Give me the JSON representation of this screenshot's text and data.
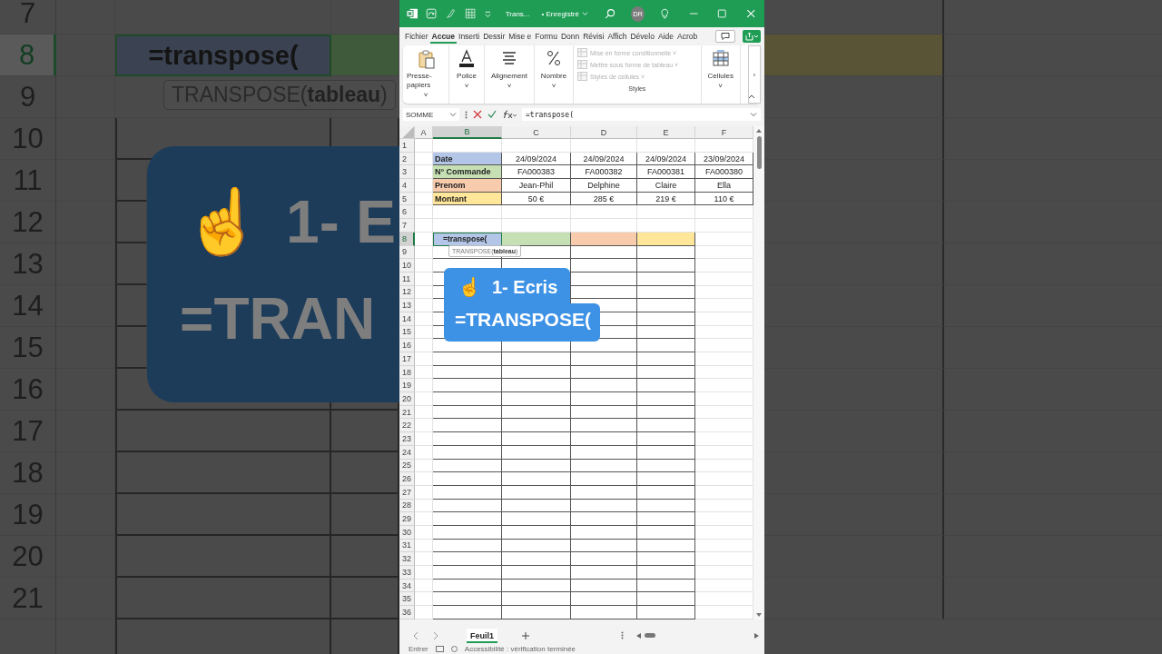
{
  "backdrop": {
    "rows": [
      {
        "number": "7",
        "selected": false
      },
      {
        "number": "8",
        "selected": true
      },
      {
        "number": "9",
        "selected": false
      },
      {
        "number": "10",
        "selected": false
      },
      {
        "number": "11",
        "selected": false
      },
      {
        "number": "12",
        "selected": false
      },
      {
        "number": "13",
        "selected": false
      },
      {
        "number": "14",
        "selected": false
      },
      {
        "number": "15",
        "selected": false
      },
      {
        "number": "16",
        "selected": false
      },
      {
        "number": "17",
        "selected": false
      },
      {
        "number": "18",
        "selected": false
      },
      {
        "number": "19",
        "selected": false
      },
      {
        "number": "20",
        "selected": false
      },
      {
        "number": "21",
        "selected": false
      }
    ],
    "cell_text": "=transpose(",
    "tooltip": "TRANSPOSE(**tableau**)",
    "callout_icon": "☝",
    "callout_lines": [
      "1- E",
      "=TRAN"
    ]
  },
  "window": {
    "title": "Trans...",
    "save_status": "• Enregistré",
    "avatar": "DR"
  },
  "ribbon_tabs": [
    {
      "label": "Fichier",
      "selected": false
    },
    {
      "label": "Accue",
      "selected": true
    },
    {
      "label": "Inserti",
      "selected": false
    },
    {
      "label": "Dessir",
      "selected": false
    },
    {
      "label": "Mise e",
      "selected": false
    },
    {
      "label": "Formu",
      "selected": false
    },
    {
      "label": "Donn",
      "selected": false
    },
    {
      "label": "Révisi",
      "selected": false
    },
    {
      "label": "Affich",
      "selected": false
    },
    {
      "label": "Dévelo",
      "selected": false
    },
    {
      "label": "Aide",
      "selected": false
    },
    {
      "label": "Acrob",
      "selected": false
    }
  ],
  "ribbon_groups": [
    {
      "kind": "clipboard",
      "label": "Presse-papiers",
      "caret": "˅"
    },
    {
      "kind": "font",
      "label": "Police",
      "caret": "˅"
    },
    {
      "kind": "align",
      "label": "Alignement",
      "caret": "˅"
    },
    {
      "kind": "number",
      "label": "Nombre",
      "caret": "˅"
    },
    {
      "kind": "styles",
      "label": "Styles",
      "items": [
        {
          "label": "Mise en forme conditionnelle ˅",
          "disabled": true
        },
        {
          "label": "Mettre sous forme de tableau ˅",
          "disabled": true
        },
        {
          "label": "Styles de cellules ˅",
          "disabled": true
        }
      ]
    },
    {
      "kind": "cells",
      "label": "Cellules",
      "caret": "˅"
    }
  ],
  "ribbon_more": "›",
  "formula_bar": {
    "name_box": "SOMME",
    "formula": "=transpose("
  },
  "columns": [
    {
      "label": "A",
      "selected": false
    },
    {
      "label": "B",
      "selected": true
    },
    {
      "label": "C",
      "selected": false
    },
    {
      "label": "D",
      "selected": false
    },
    {
      "label": "E",
      "selected": false
    },
    {
      "label": "F",
      "selected": false
    }
  ],
  "rows": [
    {
      "number": "1",
      "selected": false
    },
    {
      "number": "2",
      "selected": false,
      "cells": [
        {
          "kind": "label",
          "text": "Date",
          "color": "#b4c6e7"
        },
        {
          "kind": "value",
          "text": "24/09/2024"
        },
        {
          "kind": "value",
          "text": "24/09/2024"
        },
        {
          "kind": "value",
          "text": "24/09/2024"
        },
        {
          "kind": "value",
          "text": "23/09/2024"
        }
      ]
    },
    {
      "number": "3",
      "selected": false,
      "cells": [
        {
          "kind": "label",
          "text": "N° Commande",
          "color": "#c6e0b4"
        },
        {
          "kind": "value",
          "text": "FA000383"
        },
        {
          "kind": "value",
          "text": "FA000382"
        },
        {
          "kind": "value",
          "text": "FA000381"
        },
        {
          "kind": "value",
          "text": "FA000380"
        }
      ]
    },
    {
      "number": "4",
      "selected": false,
      "cells": [
        {
          "kind": "label",
          "text": "Prenom",
          "color": "#f8cbad"
        },
        {
          "kind": "value",
          "text": "Jean-Phil"
        },
        {
          "kind": "value",
          "text": "Delphine"
        },
        {
          "kind": "value",
          "text": "Claire"
        },
        {
          "kind": "value",
          "text": "Ella"
        }
      ]
    },
    {
      "number": "5",
      "selected": false,
      "cells": [
        {
          "kind": "label",
          "text": "Montant",
          "color": "#ffe699"
        },
        {
          "kind": "value",
          "text": "50 €"
        },
        {
          "kind": "value",
          "text": "285 €"
        },
        {
          "kind": "value",
          "text": "219 €"
        },
        {
          "kind": "value",
          "text": "110 €"
        }
      ]
    },
    {
      "number": "6",
      "selected": false
    },
    {
      "number": "7",
      "selected": false
    },
    {
      "number": "8",
      "selected": true,
      "cells": [
        {
          "kind": "input",
          "text": "=transpose(",
          "color": "#b4c6e7"
        },
        {
          "kind": "fill",
          "color": "#c6e0b4"
        },
        {
          "kind": "fill",
          "color": "#f8cbad"
        },
        {
          "kind": "fill",
          "color": "#ffe699"
        }
      ]
    },
    {
      "number": "9",
      "selected": false,
      "boxed": true
    },
    {
      "number": "10",
      "selected": false,
      "boxed": true
    },
    {
      "number": "11",
      "selected": false,
      "boxed": true
    },
    {
      "number": "12",
      "selected": false,
      "boxed": true
    },
    {
      "number": "13",
      "selected": false,
      "boxed": true
    },
    {
      "number": "14",
      "selected": false,
      "boxed": true
    },
    {
      "number": "15",
      "selected": false,
      "boxed": true
    },
    {
      "number": "16",
      "selected": false,
      "boxed": true
    },
    {
      "number": "17",
      "selected": false,
      "boxed": true
    },
    {
      "number": "18",
      "selected": false,
      "boxed": true
    },
    {
      "number": "19",
      "selected": false,
      "boxed": true
    },
    {
      "number": "20",
      "selected": false,
      "boxed": true
    },
    {
      "number": "21",
      "selected": false,
      "boxed": true
    },
    {
      "number": "22",
      "selected": false,
      "boxed": true
    },
    {
      "number": "23",
      "selected": false,
      "boxed": true
    },
    {
      "number": "24",
      "selected": false,
      "boxed": true
    },
    {
      "number": "25",
      "selected": false,
      "boxed": true
    },
    {
      "number": "26",
      "selected": false,
      "boxed": true
    },
    {
      "number": "27",
      "selected": false,
      "boxed": true
    },
    {
      "number": "28",
      "selected": false,
      "boxed": true
    },
    {
      "number": "29",
      "selected": false,
      "boxed": true
    },
    {
      "number": "30",
      "selected": false,
      "boxed": true
    },
    {
      "number": "31",
      "selected": false,
      "boxed": true
    },
    {
      "number": "32",
      "selected": false,
      "boxed": true
    },
    {
      "number": "33",
      "selected": false,
      "boxed": true
    },
    {
      "number": "34",
      "selected": false,
      "boxed": true
    },
    {
      "number": "35",
      "selected": false,
      "boxed": true
    },
    {
      "number": "36",
      "selected": false,
      "boxed": true
    }
  ],
  "tooltip": "TRANSPOSE(**tableau**)",
  "callout": {
    "icon": "☝",
    "lines": [
      "1- Ecris",
      "=TRANSPOSE("
    ]
  },
  "sheet_tabs": [
    {
      "label": "Feuil1",
      "selected": true
    }
  ],
  "status_bar": {
    "mode": "Entrer",
    "accessibility": "Accessibilité : vérification terminée"
  }
}
